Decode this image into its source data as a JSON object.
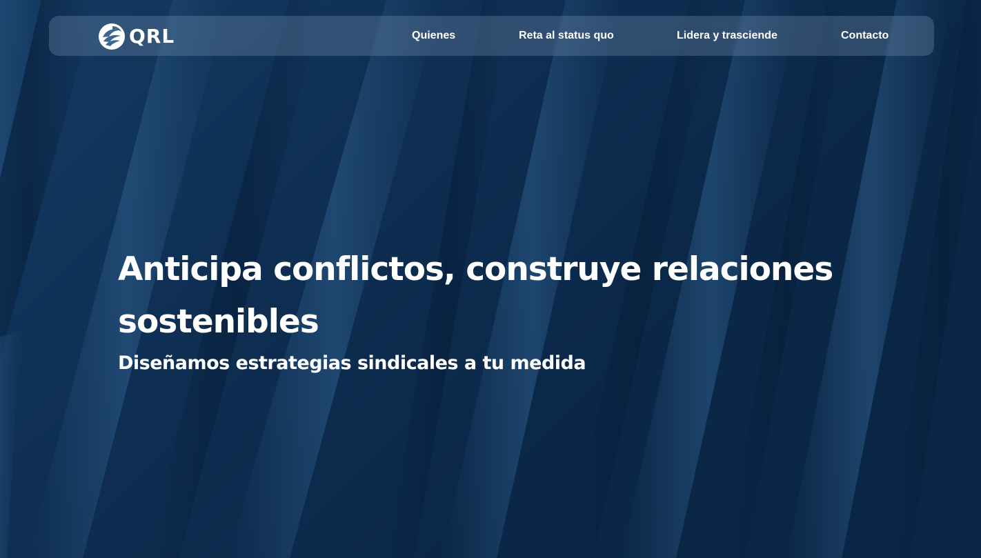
{
  "brand": {
    "name": "QRL",
    "logo_icon": "eagle-emblem-icon"
  },
  "nav": {
    "items": [
      {
        "label": "Quienes"
      },
      {
        "label": "Reta al status quo"
      },
      {
        "label": "Lidera y trasciende"
      },
      {
        "label": "Contacto"
      }
    ]
  },
  "hero": {
    "title": "Anticipa conflictos, construye relaciones sostenibles",
    "subtitle": "Diseñamos estrategias sindicales a tu medida"
  },
  "colors": {
    "background": "#0b2a4c",
    "navbar": "#5a7a9c",
    "text": "#ffffff"
  }
}
